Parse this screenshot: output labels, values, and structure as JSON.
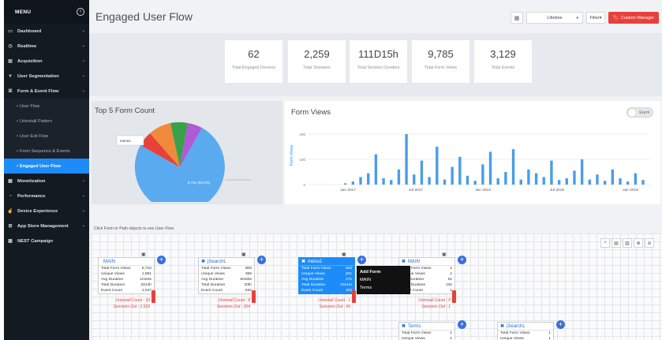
{
  "sidebar": {
    "menu_label": "MENU",
    "collapse_icon": "chevron-left-circle-icon",
    "items": [
      {
        "label": "Dashboard",
        "icon": "monitor-icon"
      },
      {
        "label": "Realtime",
        "icon": "clock-icon"
      },
      {
        "label": "Acquisition",
        "icon": "list-icon"
      },
      {
        "label": "User Segmentation",
        "icon": "funnel-icon"
      },
      {
        "label": "Form & Event Flow",
        "icon": "flow-icon"
      }
    ],
    "sub_items": [
      "User Flow",
      "Uninstall Pattern",
      "User Exit Flow",
      "Form Sequence & Events",
      "Engaged User Flow"
    ],
    "items_after": [
      {
        "label": "Monetization",
        "icon": "money-icon"
      },
      {
        "label": "Performance",
        "icon": "speedometer-icon"
      },
      {
        "label": "Device Experience",
        "icon": "thumb-icon"
      },
      {
        "label": "App Store Management",
        "icon": "cart-icon"
      },
      {
        "label": "NEST Campaign",
        "icon": "grid-icon"
      }
    ]
  },
  "header": {
    "title": "Engaged User Flow",
    "range": "Lifetime",
    "filter_label": "Filter",
    "custom_manager": "Custom Manager"
  },
  "stats": [
    {
      "value": "62",
      "label": "Total Engaged Devices"
    },
    {
      "value": "2,259",
      "label": "Total Sessions"
    },
    {
      "value": "111D15h",
      "label": "Total Session Duration"
    },
    {
      "value": "9,785",
      "label": "Total Form Views"
    },
    {
      "value": "3,129",
      "label": "Total Events"
    }
  ],
  "pie": {
    "title": "Top 5 Form Count",
    "main_label": "6,731 (94.2%)",
    "callout": "menu1",
    "colors": [
      "#5aaaf0",
      "#e8403a",
      "#f08a3a",
      "#3aa14a",
      "#b05ad8"
    ]
  },
  "form_views": {
    "title": "Form Views",
    "toggle_label": "Event",
    "y_title": "Form Views",
    "y_ticks": [
      "200",
      "100",
      "0"
    ],
    "x_ticks": [
      "Jan 2017",
      "Jul 2017",
      "Jan 2018",
      "Jul 2018",
      "Jan 2019"
    ]
  },
  "chart_data": {
    "type": "bar",
    "title": "Form Views",
    "ylabel": "Form Views",
    "ylim": [
      0,
      200
    ],
    "x_ticks": [
      "Jan 2017",
      "Jul 2017",
      "Jan 2018",
      "Jul 2018",
      "Jan 2019"
    ],
    "series": [
      {
        "values": [
          5,
          12,
          30,
          45,
          120,
          25,
          18,
          60,
          200,
          40,
          95,
          30,
          150,
          20,
          70,
          110,
          35,
          15,
          80,
          130,
          25,
          50,
          140,
          20,
          60,
          45,
          30,
          95,
          18,
          25,
          55,
          100,
          20,
          40,
          15,
          60,
          25,
          12,
          45,
          18
        ]
      }
    ]
  },
  "flow": {
    "hint": "Click Form or Path objects to see User Flow",
    "nodes": [
      {
        "title": "MAIN",
        "rows": [
          [
            "Total Form Views",
            "6,710"
          ],
          [
            "Unique Views",
            "1,981"
          ],
          [
            "Avg Duration",
            "1m53s"
          ],
          [
            "Total Duration",
            "2014h"
          ],
          [
            "Event Count",
            "1,047"
          ]
        ],
        "uninstall": "Uninstall Count : 33",
        "sessions": "Sessions Out : 1,529"
      },
      {
        "title": "jSearchL",
        "rows": [
          [
            "Total Form Views",
            "809"
          ],
          [
            "Unique Views",
            "369"
          ],
          [
            "Avg Duration",
            "5m55s"
          ],
          [
            "Total Duration",
            "20th"
          ],
          [
            "Event Count",
            "632"
          ]
        ],
        "uninstall": "Uninstall Count : 8",
        "sessions": "Sessions Out : 264"
      },
      {
        "title": "menu1",
        "rows": [
          [
            "Total Form Views",
            "343"
          ],
          [
            "Unique Views",
            "201"
          ],
          [
            "Avg Duration",
            "27s"
          ],
          [
            "Total Duration",
            "1h21m"
          ],
          [
            "Event Count",
            "103"
          ]
        ],
        "uninstall": "Uninstall Count : 1",
        "sessions": "Sessions Out : 56"
      },
      {
        "title": "MAIN",
        "rows": [
          [
            "Total Form Views",
            "2"
          ],
          [
            "Unique Views",
            "2"
          ],
          [
            "Avg Duration",
            "5s"
          ],
          [
            "Total Duration",
            "10s"
          ],
          [
            "Event Count",
            "1"
          ]
        ],
        "uninstall": "Uninstall Count : 0",
        "sessions": "Sessions Out : 1"
      },
      {
        "title": "Terms",
        "rows": [
          [
            "Total Form Views",
            "1"
          ],
          [
            "Unique Views",
            "1"
          ]
        ]
      },
      {
        "title": "jSearchL",
        "rows": [
          [
            "Total Form Views",
            "1"
          ],
          [
            "Unique Views",
            "1"
          ]
        ]
      }
    ],
    "context_menu": {
      "title": "Add Form",
      "items": [
        "MAIN",
        "Terms"
      ]
    }
  }
}
